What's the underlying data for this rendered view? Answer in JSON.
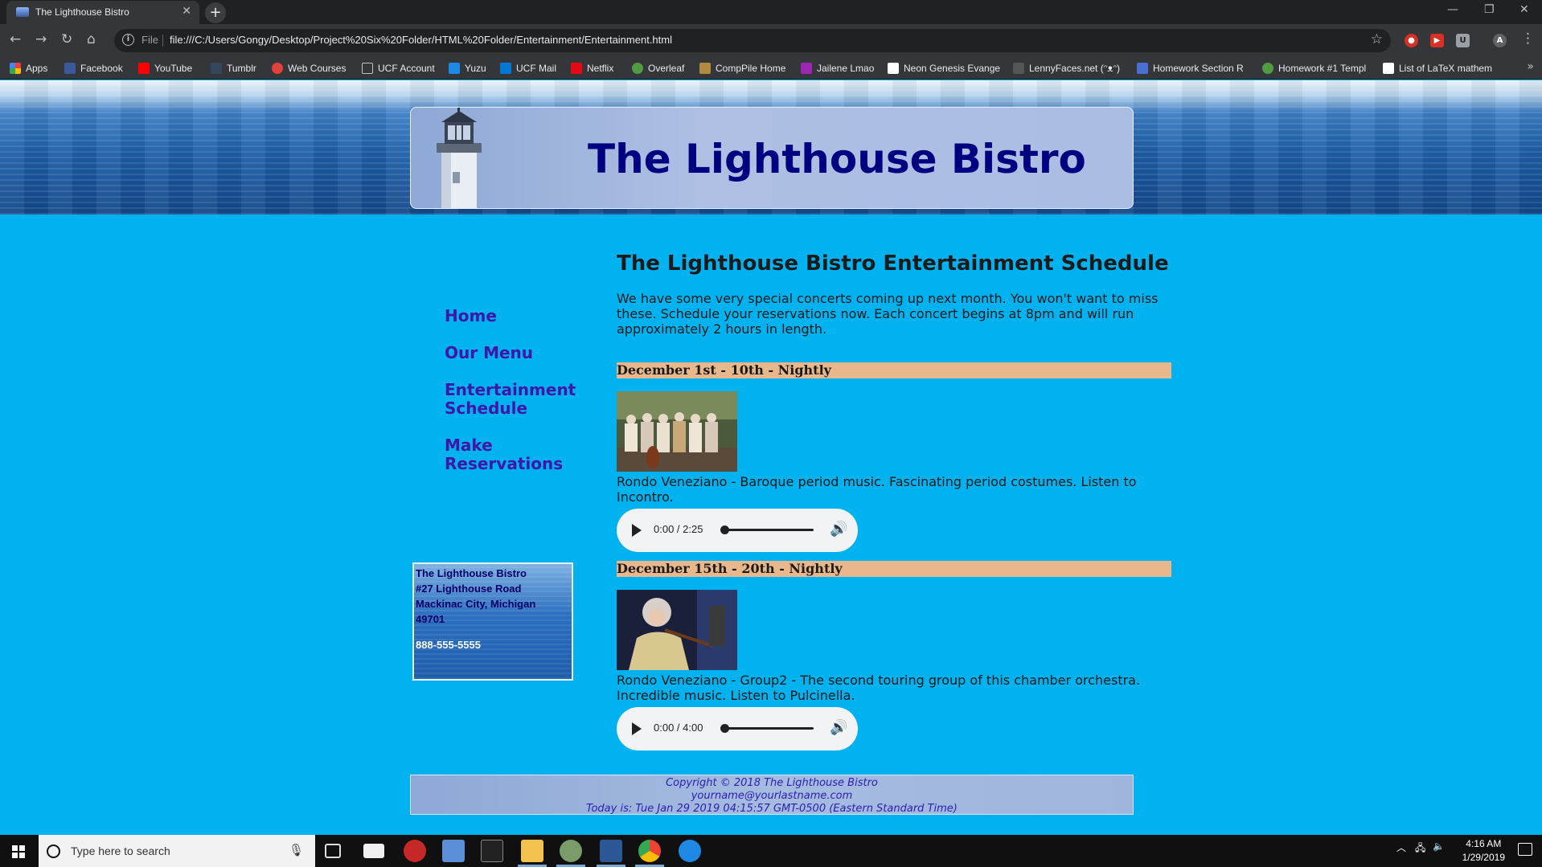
{
  "browser": {
    "tab_title": "The Lighthouse Bistro",
    "url_scheme_label": "File",
    "url": "file:///C:/Users/Gongy/Desktop/Project%20Six%20Folder/HTML%20Folder/Entertainment/Entertainment.html",
    "bookmarks": [
      "Apps",
      "Facebook",
      "YouTube",
      "Tumblr",
      "Web Courses",
      "UCF Account",
      "Yuzu",
      "UCF Mail",
      "Netflix",
      "Overleaf",
      "CompPile Home",
      "Jailene Lmao",
      "Neon Genesis Evange",
      "LennyFaces.net (ᵔᴥᵔ)",
      "Homework Section R",
      "Homework #1 Templ",
      "List of LaTeX mathem"
    ]
  },
  "site": {
    "title": "The Lighthouse Bistro",
    "nav": [
      "Home",
      "Our Menu",
      "Entertainment Schedule",
      "Make Reservations"
    ],
    "address": {
      "name": "The Lighthouse Bistro",
      "street": "#27 Lighthouse Road",
      "city": "Mackinac City, Michigan",
      "zip": "49701",
      "phone": "888-555-5555"
    },
    "main_heading": "The Lighthouse Bistro Entertainment Schedule",
    "intro": "We have some very special concerts coming up next month. You won't want to miss these. Schedule your reservations now. Each concert begins at 8pm and will run approximately 2 hours in length.",
    "events": [
      {
        "heading": "December 1st - 10th - Nightly",
        "description": "Rondo Veneziano - Baroque period music. Fascinating period costumes. Listen to Incontro.",
        "audio_time": "0:00 / 2:25",
        "progress": 0
      },
      {
        "heading": "December 15th - 20th - Nightly",
        "description": "Rondo Veneziano - Group2 - The second touring group of this chamber orchestra. Incredible music. Listen to Pulcinella.",
        "audio_time": "0:00 / 4:00",
        "progress": 0
      }
    ],
    "footer": {
      "copyright": "Copyright © 2018 The Lighthouse Bistro",
      "email": "yourname@yourlastname.com",
      "today": "Today is: Tue Jan 29 2019 04:15:57 GMT-0500 (Eastern Standard Time)"
    }
  },
  "taskbar": {
    "search_placeholder": "Type here to search",
    "time": "4:16 AM",
    "date": "1/29/2019"
  },
  "colors": {
    "page_bg": "#00b2f0",
    "title": "#000080",
    "nav_link": "#4015a8",
    "event_bar": "#e8b78b",
    "footer_text": "#2a1fb0"
  }
}
